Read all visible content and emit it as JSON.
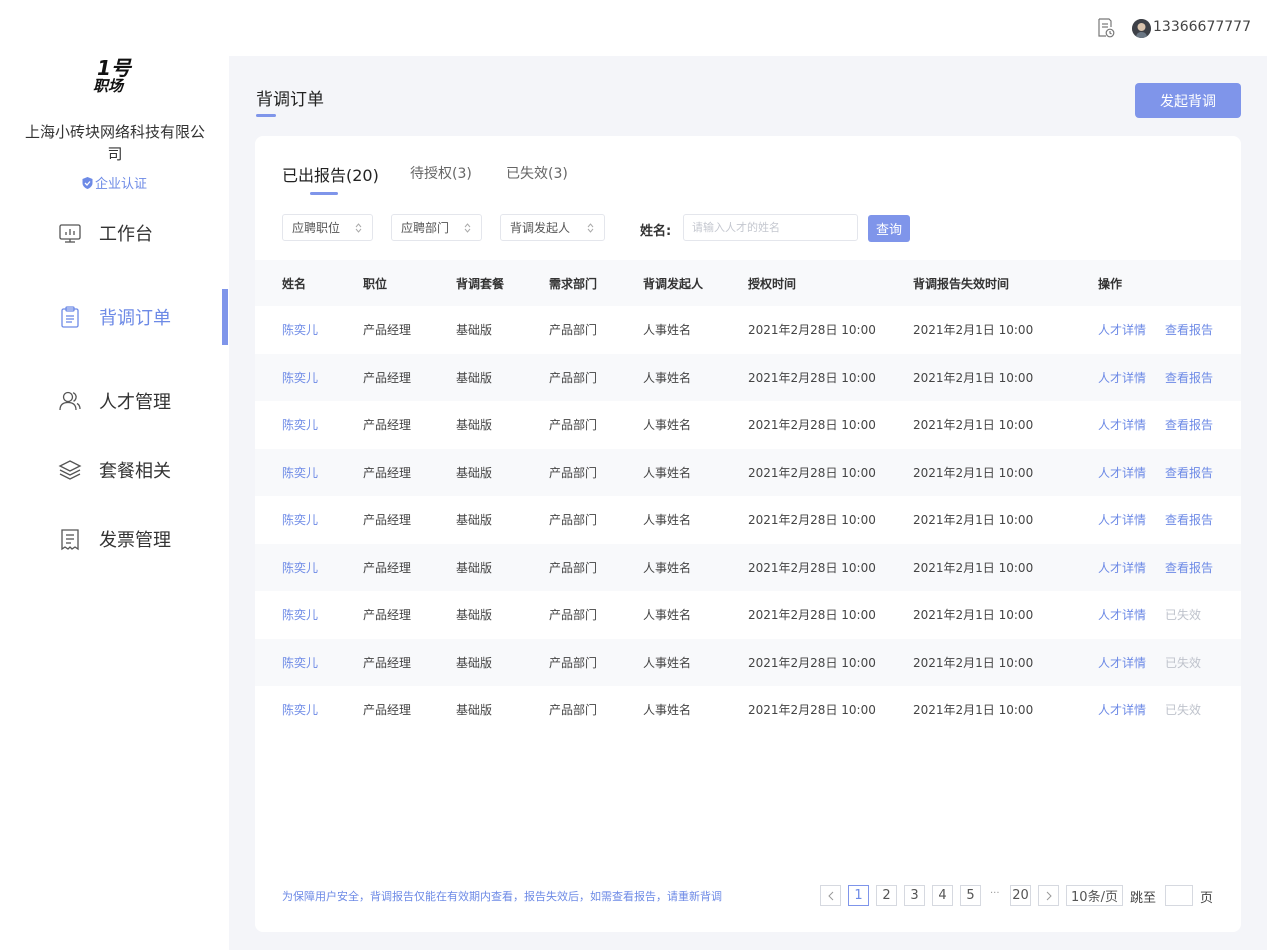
{
  "logo": {
    "line1": "1号",
    "line2": "职场"
  },
  "company": {
    "name": "上海小砖块网络科技有限公司",
    "cert_label": "企业认证"
  },
  "sidebar": {
    "items": [
      {
        "label": "工作台",
        "icon": "monitor-chart-icon"
      },
      {
        "label": "背调订单",
        "icon": "clipboard-icon",
        "active": true
      },
      {
        "label": "人才管理",
        "icon": "users-icon"
      },
      {
        "label": "套餐相关",
        "icon": "layers-icon"
      },
      {
        "label": "发票管理",
        "icon": "receipt-icon"
      }
    ]
  },
  "topbar": {
    "user_phone": "13366677777"
  },
  "page": {
    "title": "背调订单",
    "launch_button": "发起背调"
  },
  "tabs": [
    {
      "label": "已出报告(20)",
      "active": true
    },
    {
      "label": "待授权(3)"
    },
    {
      "label": "已失效(3)"
    }
  ],
  "filters": {
    "position": "应聘职位",
    "department": "应聘部门",
    "initiator": "背调发起人",
    "name_label": "姓名:",
    "name_placeholder": "请输入人才的姓名",
    "query_button": "查询"
  },
  "table": {
    "headers": [
      "姓名",
      "职位",
      "背调套餐",
      "需求部门",
      "背调发起人",
      "授权时间",
      "背调报告失效时间",
      "操作"
    ],
    "rows": [
      {
        "name": "陈奕儿",
        "position": "产品经理",
        "package": "基础版",
        "department": "产品部门",
        "initiator": "人事姓名",
        "auth_time": "2021年2月28日 10:00",
        "expire_time": "2021年2月1日 10:00",
        "action1": "人才详情",
        "action2": "查看报告",
        "expired": false
      },
      {
        "name": "陈奕儿",
        "position": "产品经理",
        "package": "基础版",
        "department": "产品部门",
        "initiator": "人事姓名",
        "auth_time": "2021年2月28日 10:00",
        "expire_time": "2021年2月1日 10:00",
        "action1": "人才详情",
        "action2": "查看报告",
        "expired": false
      },
      {
        "name": "陈奕儿",
        "position": "产品经理",
        "package": "基础版",
        "department": "产品部门",
        "initiator": "人事姓名",
        "auth_time": "2021年2月28日 10:00",
        "expire_time": "2021年2月1日 10:00",
        "action1": "人才详情",
        "action2": "查看报告",
        "expired": false
      },
      {
        "name": "陈奕儿",
        "position": "产品经理",
        "package": "基础版",
        "department": "产品部门",
        "initiator": "人事姓名",
        "auth_time": "2021年2月28日 10:00",
        "expire_time": "2021年2月1日 10:00",
        "action1": "人才详情",
        "action2": "查看报告",
        "expired": false
      },
      {
        "name": "陈奕儿",
        "position": "产品经理",
        "package": "基础版",
        "department": "产品部门",
        "initiator": "人事姓名",
        "auth_time": "2021年2月28日 10:00",
        "expire_time": "2021年2月1日 10:00",
        "action1": "人才详情",
        "action2": "查看报告",
        "expired": false
      },
      {
        "name": "陈奕儿",
        "position": "产品经理",
        "package": "基础版",
        "department": "产品部门",
        "initiator": "人事姓名",
        "auth_time": "2021年2月28日 10:00",
        "expire_time": "2021年2月1日 10:00",
        "action1": "人才详情",
        "action2": "查看报告",
        "expired": false
      },
      {
        "name": "陈奕儿",
        "position": "产品经理",
        "package": "基础版",
        "department": "产品部门",
        "initiator": "人事姓名",
        "auth_time": "2021年2月28日 10:00",
        "expire_time": "2021年2月1日 10:00",
        "action1": "人才详情",
        "action2": "已失效",
        "expired": true
      },
      {
        "name": "陈奕儿",
        "position": "产品经理",
        "package": "基础版",
        "department": "产品部门",
        "initiator": "人事姓名",
        "auth_time": "2021年2月28日 10:00",
        "expire_time": "2021年2月1日 10:00",
        "action1": "人才详情",
        "action2": "已失效",
        "expired": true
      },
      {
        "name": "陈奕儿",
        "position": "产品经理",
        "package": "基础版",
        "department": "产品部门",
        "initiator": "人事姓名",
        "auth_time": "2021年2月28日 10:00",
        "expire_time": "2021年2月1日 10:00",
        "action1": "人才详情",
        "action2": "已失效",
        "expired": true
      }
    ]
  },
  "footer": {
    "note": "为保障用户安全，背调报告仅能在有效期内查看，报告失效后，如需查看报告，请重新背调",
    "pages": [
      "1",
      "2",
      "3",
      "4",
      "5"
    ],
    "current_page": "1",
    "ellipsis": "···",
    "last_page": "20",
    "page_size": "10条/页",
    "goto_label": "跳至",
    "page_unit": "页"
  },
  "colors": {
    "accent": "#7f95ea",
    "link": "#6d8ae6",
    "background": "#f4f5f9"
  }
}
